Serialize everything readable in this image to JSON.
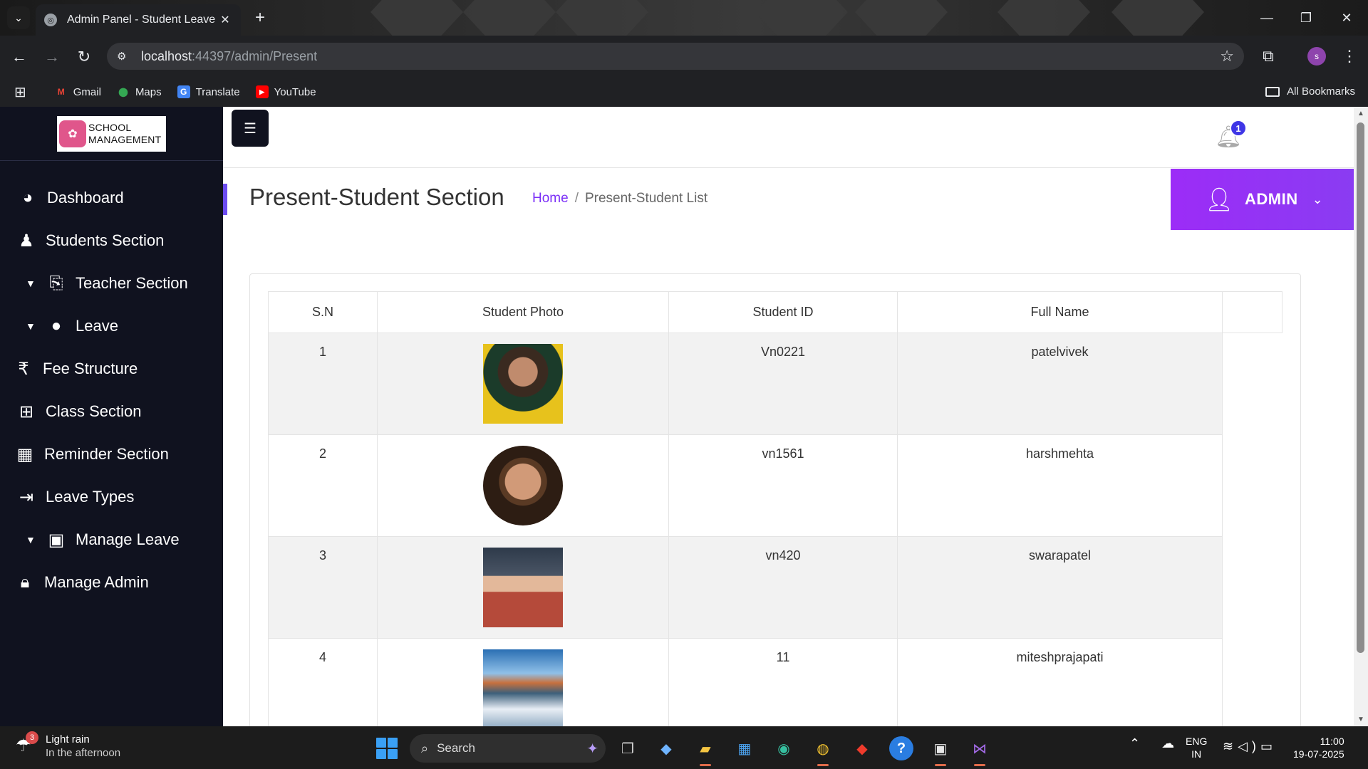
{
  "browser": {
    "tab_title": "Admin Panel - Student Leave",
    "tab_close": "✕",
    "new_tab": "+",
    "url_host": "localhost",
    "url_path": ":44397/admin/Present",
    "profile_initial": "s",
    "bookmarks": [
      {
        "label": "Gmail",
        "icon": "gmail-icon",
        "color": "#ea4335"
      },
      {
        "label": "Maps",
        "icon": "maps-pin-icon",
        "color": "#34a853"
      },
      {
        "label": "Translate",
        "icon": "translate-icon",
        "color": "#4285f4"
      },
      {
        "label": "YouTube",
        "icon": "youtube-icon",
        "color": "#ff0000"
      }
    ],
    "all_bookmarks": "All Bookmarks"
  },
  "sidebar": {
    "logo_line1": "SCHOOL",
    "logo_line2": "MANAGEMENT",
    "items": [
      {
        "label": "Dashboard",
        "icon": "dashboard-gauge-icon",
        "caret": false
      },
      {
        "label": "Students Section",
        "icon": "student-icon",
        "caret": false
      },
      {
        "label": "Teacher Section",
        "icon": "teacher-board-icon",
        "caret": true
      },
      {
        "label": "Leave",
        "icon": "user-icon",
        "caret": true
      },
      {
        "label": "Fee Structure",
        "icon": "rupee-icon",
        "caret": false
      },
      {
        "label": "Class Section",
        "icon": "grid-table-icon",
        "caret": false
      },
      {
        "label": "Reminder Section",
        "icon": "calendar-icon",
        "caret": false
      },
      {
        "label": "Leave Types",
        "icon": "sign-out-icon",
        "caret": false
      },
      {
        "label": "Manage Leave",
        "icon": "briefcase-icon",
        "caret": true
      },
      {
        "label": "Manage Admin",
        "icon": "lock-icon",
        "caret": false
      }
    ]
  },
  "topbar": {
    "notification_count": "1"
  },
  "header": {
    "page_title": "Present-Student Section",
    "breadcrumb_home": "Home",
    "breadcrumb_sep": "/",
    "breadcrumb_current": "Present-Student List",
    "admin_label": "ADMIN"
  },
  "table": {
    "columns": [
      "S.N",
      "Student Photo",
      "Student ID",
      "Full Name",
      ""
    ],
    "rows": [
      {
        "sn": "1",
        "student_id": "Vn0221",
        "full_name": "patelvivek"
      },
      {
        "sn": "2",
        "student_id": "vn1561",
        "full_name": "harshmehta"
      },
      {
        "sn": "3",
        "student_id": "vn420",
        "full_name": "swarapatel"
      },
      {
        "sn": "4",
        "student_id": "11",
        "full_name": "miteshprajapati"
      }
    ]
  },
  "taskbar": {
    "weather_badge": "3",
    "weather_line1": "Light rain",
    "weather_line2": "In the afternoon",
    "search_label": "Search",
    "lang_line1": "ENG",
    "lang_line2": "IN",
    "time": "11:00",
    "date": "19-07-2025"
  }
}
